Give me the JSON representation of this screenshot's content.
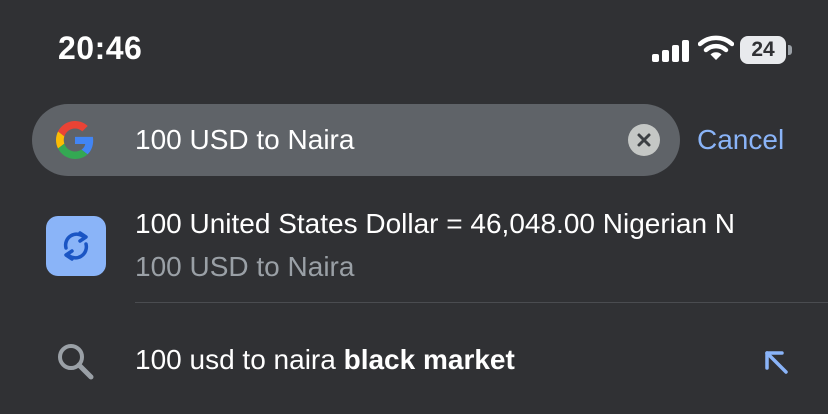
{
  "status_bar": {
    "time": "20:46",
    "battery": "24"
  },
  "search": {
    "query": "100 USD to Naira",
    "cancel_label": "Cancel"
  },
  "suggestions": {
    "conversion": {
      "title": "100 United States Dollar = 46,048.00 Nigerian N",
      "subtitle": "100 USD to Naira"
    },
    "query": {
      "prefix": "100 usd to naira ",
      "bold": "black market"
    }
  },
  "colors": {
    "background": "#303134",
    "search_bar": "#5f6368",
    "accent": "#8ab4f8",
    "secondary_text": "#9aa0a6"
  },
  "icons": [
    "google-icon",
    "clear-icon",
    "currency-convert-icon",
    "search-icon",
    "arrow-up-left-icon",
    "signal-icon",
    "wifi-icon",
    "battery-icon"
  ]
}
